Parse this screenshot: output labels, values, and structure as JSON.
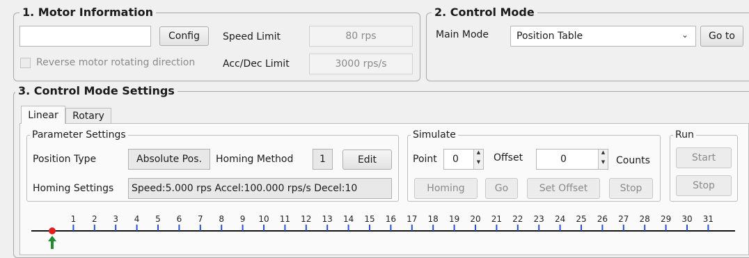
{
  "motor_info": {
    "title": "1.  Motor Information",
    "motor_name_value": "",
    "config_label": "Config",
    "speed_limit_label": "Speed Limit",
    "speed_limit_value": "80 rps",
    "reverse_label": "Reverse motor rotating direction",
    "reverse_checked": false,
    "acc_dec_label": "Acc/Dec Limit",
    "acc_dec_value": "3000 rps/s"
  },
  "control_mode": {
    "title": "2. Control Mode",
    "main_mode_label": "Main Mode",
    "main_mode_value": "Position Table",
    "goto_label": "Go to"
  },
  "settings": {
    "title": "3. Control Mode Settings",
    "tabs": [
      {
        "label": "Linear",
        "active": true
      },
      {
        "label": "Rotary",
        "active": false
      }
    ],
    "params": {
      "title": "Parameter Settings",
      "position_type_label": "Position Type",
      "position_type_value": "Absolute Pos.",
      "homing_method_label": "Homing Method",
      "homing_method_value": "1",
      "edit_label": "Edit",
      "homing_settings_label": "Homing Settings",
      "homing_settings_value": "Speed:5.000 rps Accel:100.000 rps/s Decel:10"
    },
    "simulate": {
      "title": "Simulate",
      "point_label": "Point",
      "point_value": "0",
      "offset_label": "Offset",
      "offset_value": "0",
      "counts_label": "Counts",
      "homing_label": "Homing",
      "go_label": "Go",
      "set_offset_label": "Set Offset",
      "stop_label": "Stop"
    },
    "run": {
      "title": "Run",
      "start_label": "Start",
      "stop_label": "Stop"
    },
    "ruler": {
      "ticks": [
        "1",
        "2",
        "3",
        "4",
        "5",
        "6",
        "7",
        "8",
        "9",
        "10",
        "11",
        "12",
        "13",
        "14",
        "15",
        "16",
        "17",
        "18",
        "19",
        "20",
        "21",
        "22",
        "23",
        "24",
        "25",
        "26",
        "27",
        "28",
        "29",
        "30",
        "31"
      ],
      "current_position": 0,
      "marker_color": "#e02020",
      "arrow_color": "#1f8a2e",
      "tick_color": "#2a4fc4"
    }
  }
}
